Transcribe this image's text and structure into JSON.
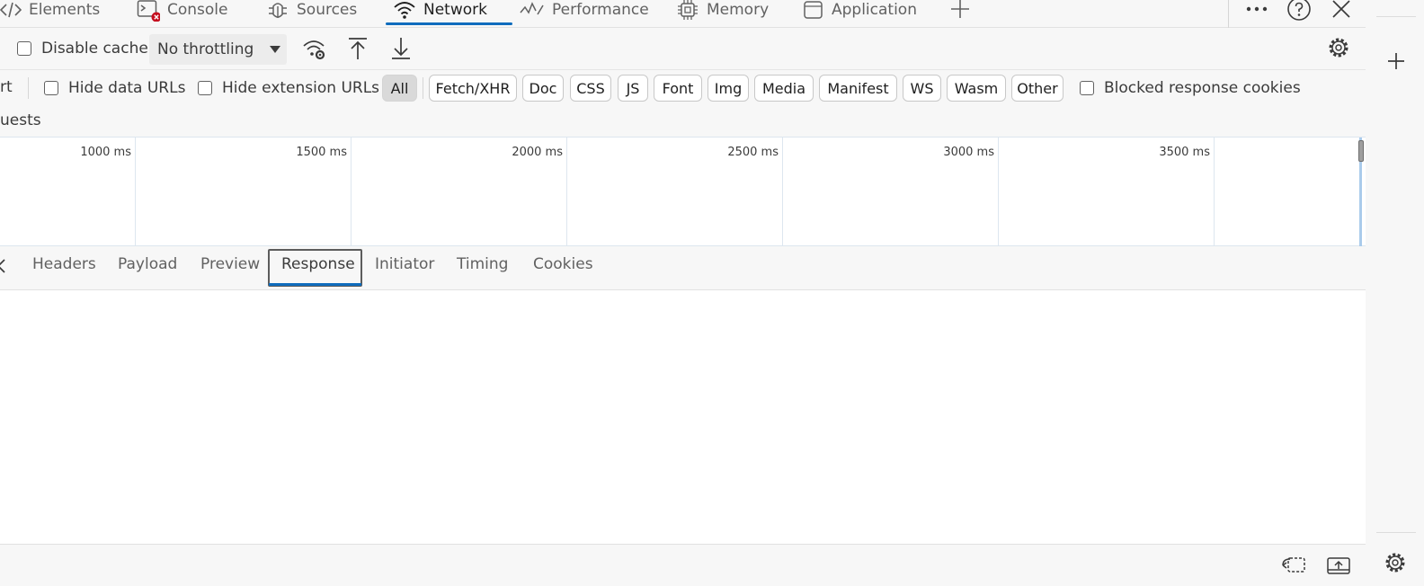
{
  "panel_tabs": [
    {
      "label": "Elements",
      "icon": "code-icon"
    },
    {
      "label": "Console",
      "icon": "console-icon"
    },
    {
      "label": "Sources",
      "icon": "bug-icon"
    },
    {
      "label": "Network",
      "icon": "wifi-icon"
    },
    {
      "label": "Performance",
      "icon": "performance-icon"
    },
    {
      "label": "Memory",
      "icon": "chip-icon"
    },
    {
      "label": "Application",
      "icon": "application-icon"
    }
  ],
  "active_panel_tab": "Network",
  "toolbar": {
    "disable_cache_label": "Disable cache",
    "disable_cache_checked": false,
    "throttling_value": "No throttling"
  },
  "filter": {
    "left_clip": "rt",
    "hide_data_urls_label": "Hide data URLs",
    "hide_extension_urls_label": "Hide extension URLs",
    "types": [
      "All",
      "Fetch/XHR",
      "Doc",
      "CSS",
      "JS",
      "Font",
      "Img",
      "Media",
      "Manifest",
      "WS",
      "Wasm",
      "Other"
    ],
    "active_type": "All",
    "blocked_response_cookies_label": "Blocked response cookies"
  },
  "requests_clip": "uests",
  "timeline": {
    "ticks": [
      "1000 ms",
      "1500 ms",
      "2000 ms",
      "2500 ms",
      "3000 ms",
      "3500 ms"
    ]
  },
  "detail_tabs": [
    "Headers",
    "Payload",
    "Preview",
    "Response",
    "Initiator",
    "Timing",
    "Cookies"
  ],
  "active_detail_tab": "Response",
  "accent_color": "#0f6cbd",
  "console_error_badge_color": "#c50f1f"
}
